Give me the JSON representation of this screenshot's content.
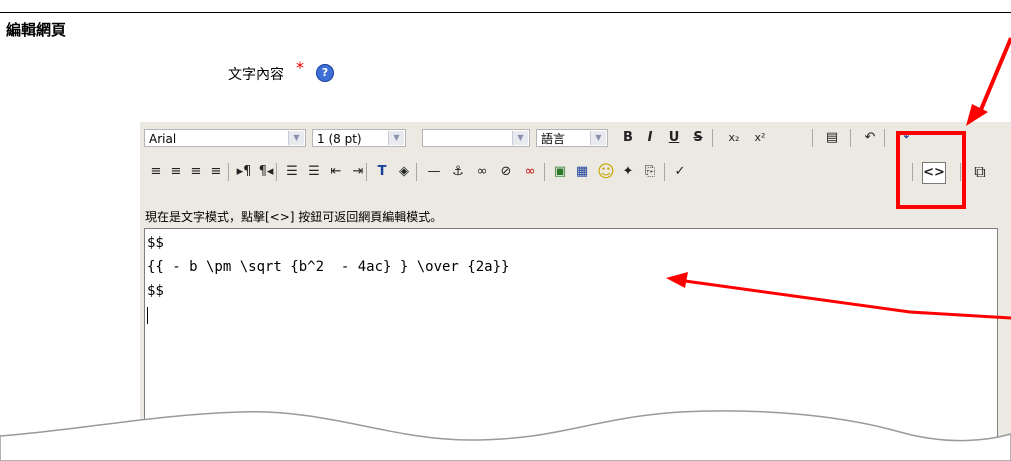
{
  "page": {
    "legend": "編輯網頁",
    "field_label": "文字內容",
    "required_mark": "*",
    "help_icon": "?"
  },
  "toolbar": {
    "font_family": "Arial",
    "font_size": "1 (8 pt)",
    "style_select": "",
    "language_select": "語言",
    "row1_buttons": [
      {
        "name": "bold-button",
        "icon": "bold-icon",
        "glyph": "B"
      },
      {
        "name": "italic-button",
        "icon": "italic-icon",
        "glyph": "I"
      },
      {
        "name": "underline-button",
        "icon": "underline-icon",
        "glyph": "U"
      },
      {
        "name": "strikethrough-button",
        "icon": "strikethrough-icon",
        "glyph": "S"
      },
      {
        "name": "subscript-button",
        "icon": "subscript-icon",
        "glyph": "x₂"
      },
      {
        "name": "superscript-button",
        "icon": "superscript-icon",
        "glyph": "x²"
      },
      {
        "name": "clean-word-button",
        "icon": "word-icon",
        "glyph": "▤"
      },
      {
        "name": "undo-button",
        "icon": "undo-icon",
        "glyph": "↶"
      },
      {
        "name": "redo-button",
        "icon": "redo-icon",
        "glyph": "↷"
      }
    ],
    "row2_buttons": [
      {
        "name": "align-left-button",
        "icon": "align-left-icon",
        "glyph": "≡"
      },
      {
        "name": "align-center-button",
        "icon": "align-center-icon",
        "glyph": "≡"
      },
      {
        "name": "align-right-button",
        "icon": "align-right-icon",
        "glyph": "≡"
      },
      {
        "name": "justify-button",
        "icon": "justify-icon",
        "glyph": "≡"
      },
      {
        "name": "ltr-button",
        "icon": "ltr-icon",
        "glyph": "▸¶"
      },
      {
        "name": "rtl-button",
        "icon": "rtl-icon",
        "glyph": "¶◂"
      },
      {
        "name": "ordered-list-button",
        "icon": "ordered-list-icon",
        "glyph": "☰"
      },
      {
        "name": "unordered-list-button",
        "icon": "unordered-list-icon",
        "glyph": "☰"
      },
      {
        "name": "outdent-button",
        "icon": "outdent-icon",
        "glyph": "⇤"
      },
      {
        "name": "indent-button",
        "icon": "indent-icon",
        "glyph": "⇥"
      },
      {
        "name": "text-color-button",
        "icon": "text-color-icon",
        "glyph": "T"
      },
      {
        "name": "background-color-button",
        "icon": "paint-bucket-icon",
        "glyph": "◈"
      },
      {
        "name": "horizontal-rule-button",
        "icon": "horizontal-rule-icon",
        "glyph": "—"
      },
      {
        "name": "anchor-button",
        "icon": "anchor-icon",
        "glyph": "⚓"
      },
      {
        "name": "link-button",
        "icon": "link-icon",
        "glyph": "∞"
      },
      {
        "name": "unlink-button",
        "icon": "unlink-icon",
        "glyph": "⊘"
      },
      {
        "name": "nolink-button",
        "icon": "nolink-icon",
        "glyph": "∞"
      },
      {
        "name": "insert-image-button",
        "icon": "image-icon",
        "glyph": "▣"
      },
      {
        "name": "insert-table-button",
        "icon": "table-icon",
        "glyph": "▦"
      },
      {
        "name": "smiley-button",
        "icon": "smiley-icon",
        "glyph": "☺"
      },
      {
        "name": "special-char-button",
        "icon": "special-char-icon",
        "glyph": "✦"
      },
      {
        "name": "search-replace-button",
        "icon": "search-replace-icon",
        "glyph": "⎘"
      },
      {
        "name": "spellcheck-button",
        "icon": "spellcheck-icon",
        "glyph": "✓"
      },
      {
        "name": "html-mode-button",
        "icon": "code-icon",
        "glyph": "<>"
      },
      {
        "name": "fullscreen-button",
        "icon": "fullscreen-icon",
        "glyph": "⧉"
      }
    ]
  },
  "status_bar": {
    "text": "現在是文字模式，點擊[<>] 按鈕可返回網頁編輯模式。"
  },
  "textarea": {
    "line1": "$$",
    "line2": "{{ - b \\pm \\sqrt {b^2  - 4ac} } \\over {2a}}",
    "line3": "$$"
  },
  "annotation": {
    "color": "#ff0000"
  }
}
